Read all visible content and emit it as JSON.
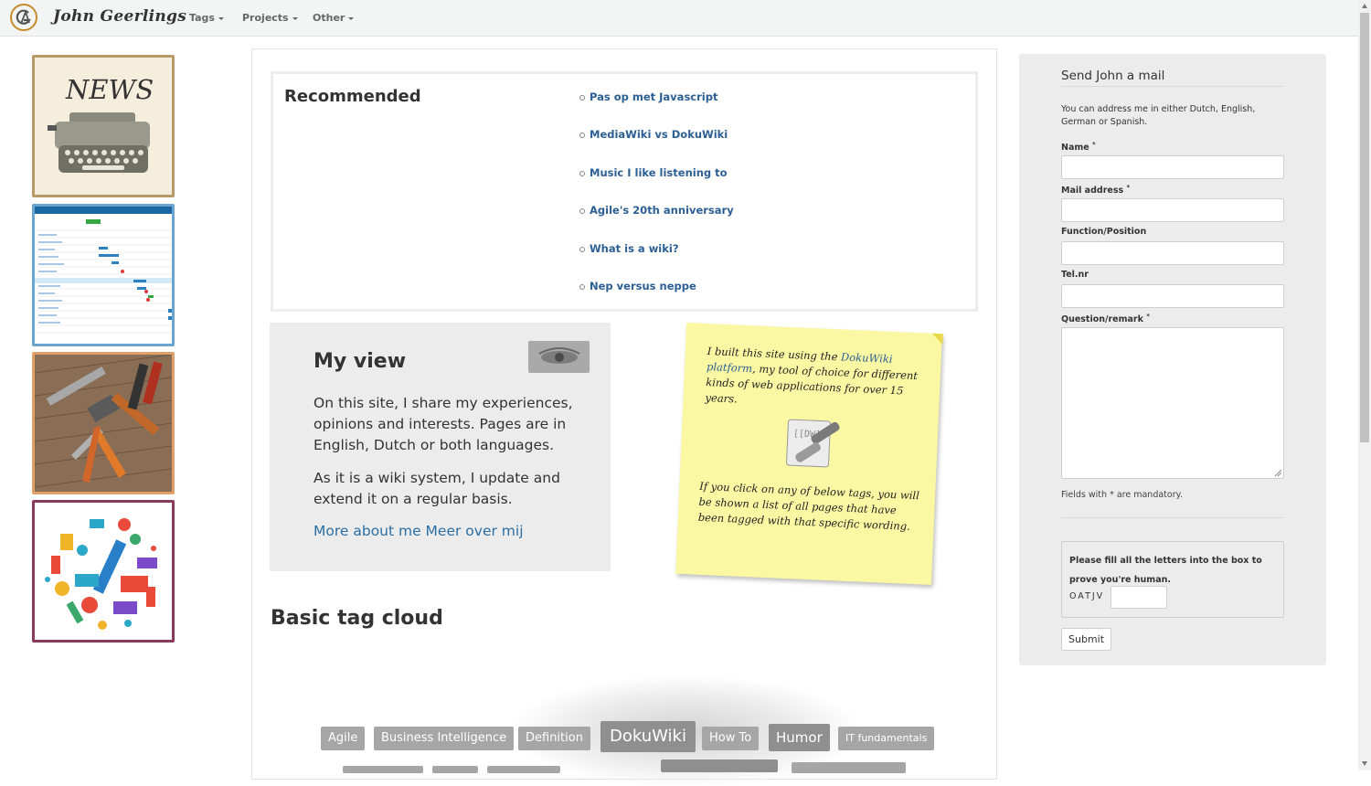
{
  "nav": {
    "brand": "John Geerlings",
    "menus": [
      {
        "label": "Tags"
      },
      {
        "label": "Projects"
      },
      {
        "label": "Other"
      }
    ]
  },
  "sidebar_tiles": [
    {
      "name": "news-tile",
      "caption": "NEWS",
      "border": "#b79a6a"
    },
    {
      "name": "project-plan-tile",
      "border": "#6aa4cf"
    },
    {
      "name": "tools-tile",
      "border": "#e0a06a"
    },
    {
      "name": "music-tile",
      "border": "#8a3a5a"
    }
  ],
  "recommended": {
    "title": "Recommended",
    "links": [
      "Pas op met Javascript",
      "MediaWiki vs DokuWiki",
      "Music I like listening to",
      "Agile's 20th anniversary",
      "What is a wiki?",
      "Nep versus neppe"
    ]
  },
  "myview": {
    "title": "My view",
    "para1": "On this site, I share my experiences, opinions and interests. Pages are in English, Dutch or both languages.",
    "para2": "As it is a wiki system, I update and extend it on a regular basis.",
    "more_link": "More about me Meer over mij"
  },
  "sticky": {
    "intro_before": "I built this site using the ",
    "intro_link": "DokuWiki platform",
    "intro_after": ", my tool of choice for different kinds of web applications for over 15 years.",
    "outro": "If you click on any of below tags, you will be shown a list of all pages that have been tagged with that specific wording.",
    "logo_text": "[[DW]]"
  },
  "tagcloud": {
    "title": "Basic tag cloud",
    "tags": [
      "Agile",
      "Business Intelligence",
      "Definition",
      "DokuWiki",
      "How To",
      "Humor",
      "IT fundamentals"
    ]
  },
  "form": {
    "title": "Send John a mail",
    "note": "You can address me in either Dutch, English, German or Spanish.",
    "fields": [
      {
        "label": "Name",
        "required": "*"
      },
      {
        "label": "Mail address",
        "required": "*"
      },
      {
        "label": "Function/Position",
        "required": ""
      },
      {
        "label": "Tel.nr",
        "required": ""
      },
      {
        "label": "Question/remark",
        "required": "*"
      }
    ],
    "mandatory_note": "Fields with * are mandatory.",
    "captcha_prompt": "Please fill all the letters into the box to prove you're human.",
    "captcha_letters": "OATJV",
    "submit_label": "Submit"
  },
  "colors": {
    "link": "#2b5f94",
    "tag_bg": "#a6a6a6",
    "sticky_bg": "#fbf8a4",
    "panel_bg": "#ececec"
  }
}
